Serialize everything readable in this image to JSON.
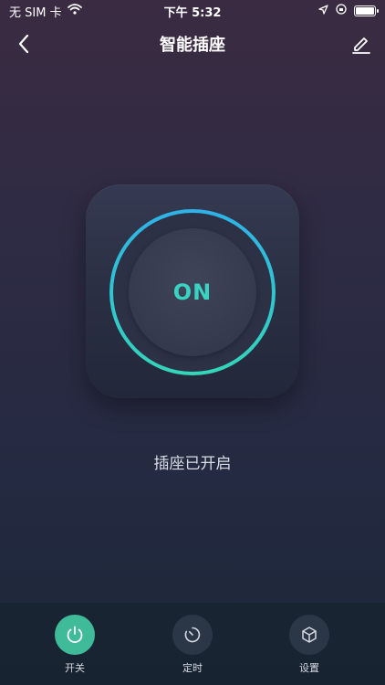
{
  "status_bar": {
    "carrier": "无 SIM 卡",
    "time": "下午 5:32",
    "icons": [
      "wifi-icon",
      "location-icon",
      "lock-rotation-icon",
      "battery-icon"
    ]
  },
  "nav": {
    "title": "智能插座",
    "back_icon": "chevron-left-icon",
    "edit_icon": "pencil-icon"
  },
  "switch": {
    "state_label": "ON",
    "status_text": "插座已开启",
    "accent_color": "#39d3c2"
  },
  "tabs": [
    {
      "label": "开关",
      "icon": "power-icon",
      "active": true
    },
    {
      "label": "定时",
      "icon": "timer-icon",
      "active": false
    },
    {
      "label": "设置",
      "icon": "cube-icon",
      "active": false
    }
  ]
}
